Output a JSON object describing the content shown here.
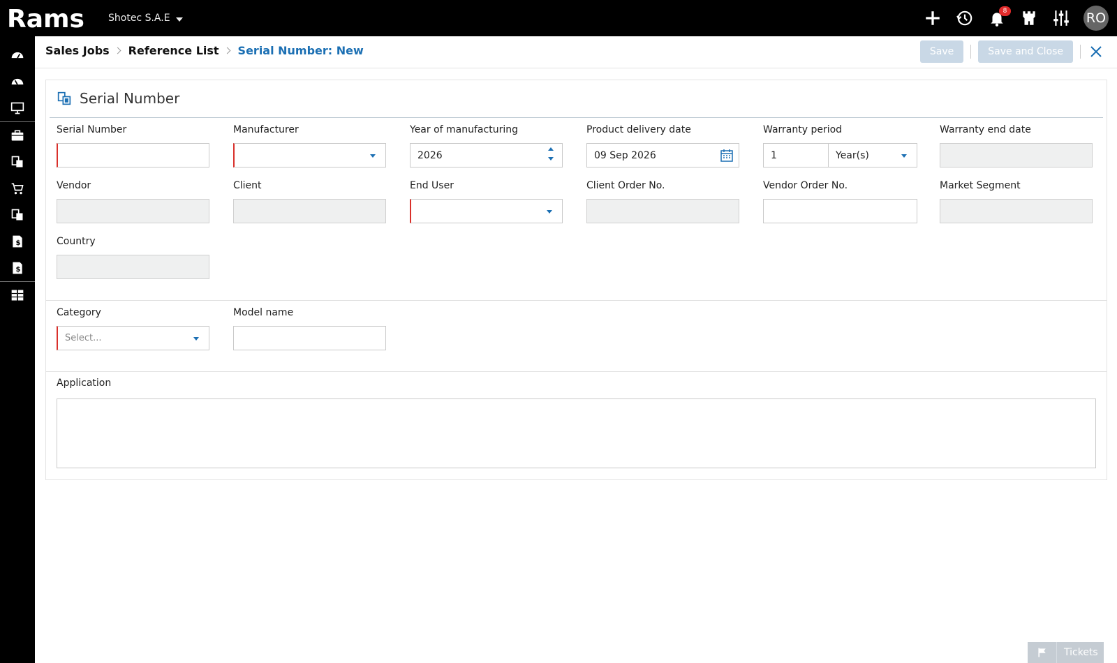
{
  "app": {
    "company": "Shotec S.A.E"
  },
  "topbar": {
    "notifications_count": "8",
    "user_initials": "RO"
  },
  "breadcrumb": {
    "items": [
      "Sales Jobs",
      "Reference List"
    ],
    "current": "Serial Number: New"
  },
  "toolbar": {
    "save_label": "Save",
    "save_close_label": "Save and Close"
  },
  "form": {
    "title": "Serial Number",
    "fields": {
      "serial_number": {
        "label": "Serial Number",
        "value": ""
      },
      "manufacturer": {
        "label": "Manufacturer",
        "value": ""
      },
      "year": {
        "label": "Year of manufacturing",
        "value": "2026"
      },
      "delivery_date": {
        "label": "Product delivery date",
        "value": "09 Sep 2026"
      },
      "warranty_period": {
        "label": "Warranty period",
        "value": "1",
        "unit": "Year(s)"
      },
      "warranty_end": {
        "label": "Warranty end date",
        "value": ""
      },
      "vendor": {
        "label": "Vendor",
        "value": ""
      },
      "client": {
        "label": "Client",
        "value": ""
      },
      "end_user": {
        "label": "End User",
        "value": ""
      },
      "client_order": {
        "label": "Client Order No.",
        "value": ""
      },
      "vendor_order": {
        "label": "Vendor Order No.",
        "value": ""
      },
      "market_segment": {
        "label": "Market Segment",
        "value": ""
      },
      "country": {
        "label": "Country",
        "value": ""
      },
      "category": {
        "label": "Category",
        "placeholder": "Select..."
      },
      "model_name": {
        "label": "Model name",
        "value": ""
      },
      "application": {
        "label": "Application",
        "value": ""
      }
    }
  },
  "footer": {
    "tickets_label": "Tickets"
  },
  "icons": {
    "topbar": [
      "plus-icon",
      "history-icon",
      "bell-icon",
      "castle-icon",
      "sliders-icon"
    ],
    "sidebar": [
      "dashboard-icon",
      "dashboard-icon",
      "monitor-icon",
      "briefcase-icon",
      "reference-icon",
      "cart-icon",
      "reference-icon",
      "invoice-icon",
      "invoice-icon",
      "modules-icon"
    ]
  },
  "colors": {
    "accent": "#1b6fb3",
    "required": "#d9302b",
    "topbar": "#000000",
    "badge": "#e32b2b"
  }
}
